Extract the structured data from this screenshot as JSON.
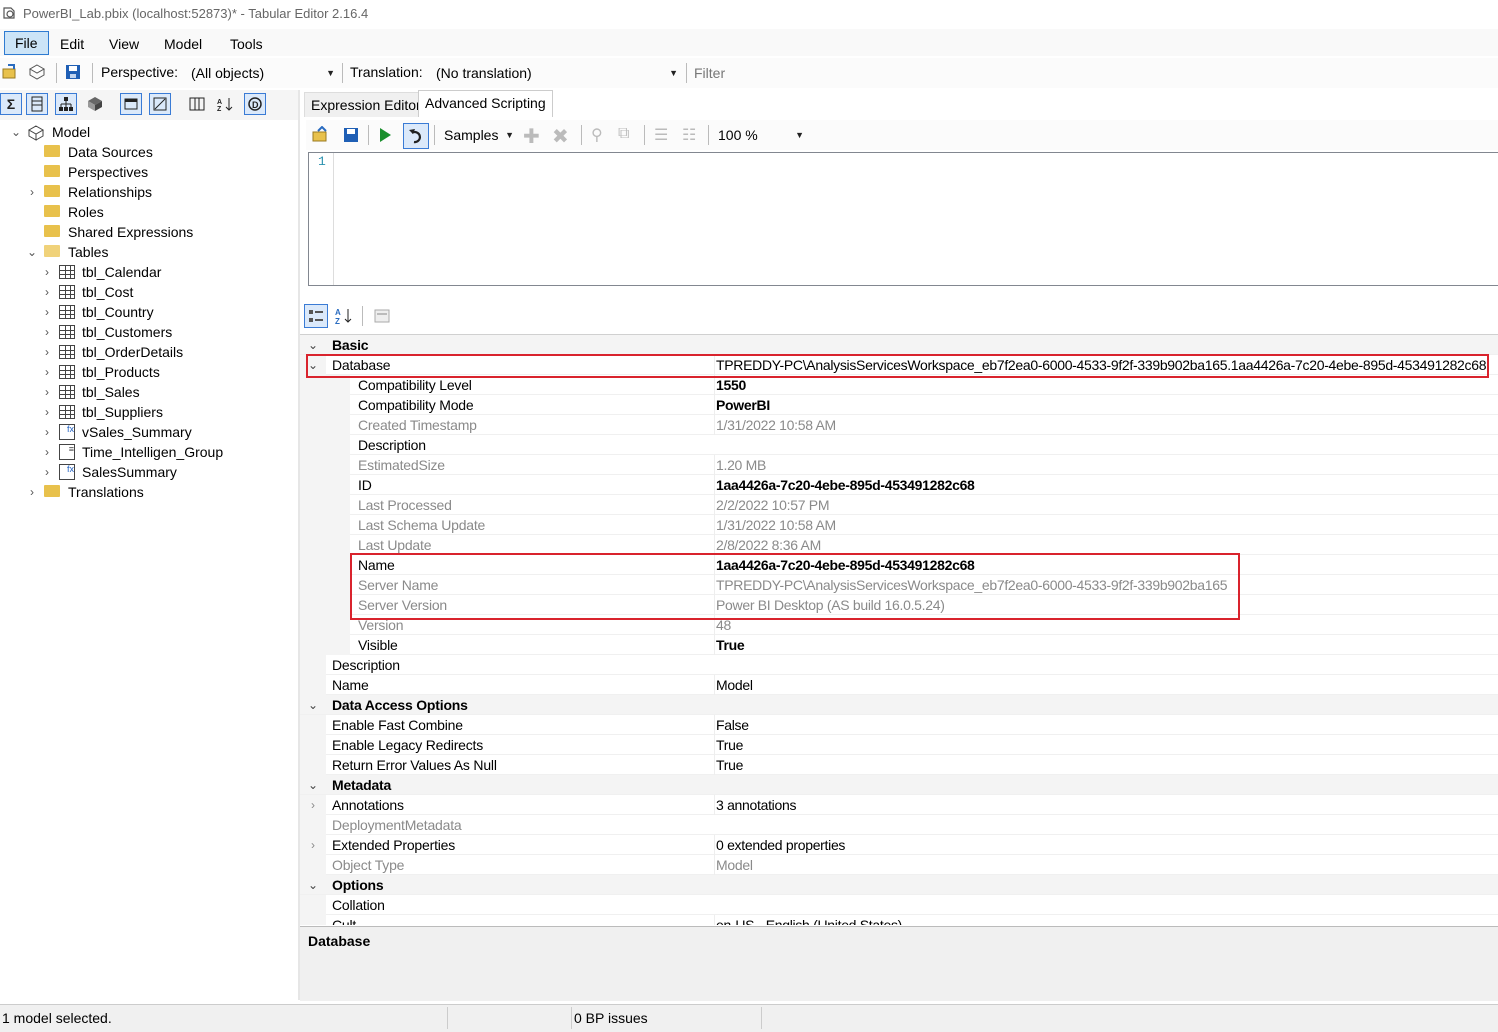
{
  "window": {
    "title": "PowerBI_Lab.pbix (localhost:52873)* - Tabular Editor 2.16.4"
  },
  "menu": {
    "items": [
      "File",
      "Edit",
      "View",
      "Model",
      "Tools"
    ]
  },
  "toolbar": {
    "perspective_label": "Perspective:",
    "perspective_value": "(All objects)",
    "translation_label": "Translation:",
    "translation_value": "(No translation)",
    "filter_placeholder": "Filter"
  },
  "tree": {
    "root": "Model",
    "items": [
      {
        "label": "Data Sources",
        "icon": "folder-icon"
      },
      {
        "label": "Perspectives",
        "icon": "folder-icon"
      },
      {
        "label": "Relationships",
        "icon": "folder-icon"
      },
      {
        "label": "Roles",
        "icon": "folder-icon"
      },
      {
        "label": "Shared Expressions",
        "icon": "folder-icon"
      },
      {
        "label": "Tables",
        "icon": "folder-open-icon"
      },
      {
        "label": "tbl_Calendar",
        "icon": "table-icon"
      },
      {
        "label": "tbl_Cost",
        "icon": "table-icon"
      },
      {
        "label": "tbl_Country",
        "icon": "table-icon"
      },
      {
        "label": "tbl_Customers",
        "icon": "table-icon"
      },
      {
        "label": "tbl_OrderDetails",
        "icon": "table-icon"
      },
      {
        "label": "tbl_Products",
        "icon": "table-icon"
      },
      {
        "label": "tbl_Sales",
        "icon": "table-icon"
      },
      {
        "label": "tbl_Suppliers",
        "icon": "table-icon"
      },
      {
        "label": "vSales_Summary",
        "icon": "calculated-table-icon"
      },
      {
        "label": "Time_Intelligen_Group",
        "icon": "calculation-group-icon"
      },
      {
        "label": "SalesSummary",
        "icon": "calculated-table-icon"
      },
      {
        "label": "Translations",
        "icon": "folder-icon"
      }
    ]
  },
  "tabs": [
    "Expression Editor",
    "Advanced Scripting"
  ],
  "script_toolbar": {
    "samples_label": "Samples",
    "zoom": "100 %"
  },
  "editor": {
    "line_number": "1"
  },
  "properties": {
    "cat_basic": "Basic",
    "database": {
      "name": "Database",
      "value": "TPREDDY-PC\\AnalysisServicesWorkspace_eb7f2ea0-6000-4533-9f2f-339b902ba165.1aa4426a-7c20-4ebe-895d-453491282c68"
    },
    "compat_level": {
      "name": "Compatibility Level",
      "value": "1550"
    },
    "compat_mode": {
      "name": "Compatibility Mode",
      "value": "PowerBI"
    },
    "created": {
      "name": "Created Timestamp",
      "value": "1/31/2022 10:58 AM"
    },
    "db_description": {
      "name": "Description",
      "value": ""
    },
    "est_size": {
      "name": "EstimatedSize",
      "value": "1.20 MB"
    },
    "id": {
      "name": "ID",
      "value": "1aa4426a-7c20-4ebe-895d-453491282c68"
    },
    "last_processed": {
      "name": "Last Processed",
      "value": "2/2/2022 10:57 PM"
    },
    "last_schema_update": {
      "name": "Last Schema Update",
      "value": "1/31/2022 10:58 AM"
    },
    "last_update": {
      "name": "Last Update",
      "value": "2/8/2022 8:36 AM"
    },
    "db_name": {
      "name": "Name",
      "value": "1aa4426a-7c20-4ebe-895d-453491282c68"
    },
    "server_name": {
      "name": "Server Name",
      "value": "TPREDDY-PC\\AnalysisServicesWorkspace_eb7f2ea0-6000-4533-9f2f-339b902ba165"
    },
    "server_version": {
      "name": "Server Version",
      "value": "Power BI Desktop (AS build 16.0.5.24)"
    },
    "version": {
      "name": "Version",
      "value": "48"
    },
    "visible": {
      "name": "Visible",
      "value": "True"
    },
    "description": {
      "name": "Description",
      "value": ""
    },
    "name": {
      "name": "Name",
      "value": "Model"
    },
    "cat_data_access": "Data Access Options",
    "fast_combine": {
      "name": "Enable Fast Combine",
      "value": "False"
    },
    "legacy_redirects": {
      "name": "Enable Legacy Redirects",
      "value": "True"
    },
    "return_error_null": {
      "name": "Return Error Values As Null",
      "value": "True"
    },
    "cat_metadata": "Metadata",
    "annotations": {
      "name": "Annotations",
      "value": "3 annotations"
    },
    "deployment_metadata": {
      "name": "DeploymentMetadata",
      "value": ""
    },
    "extended_props": {
      "name": "Extended Properties",
      "value": "0 extended properties"
    },
    "object_type": {
      "name": "Object Type",
      "value": "Model"
    },
    "cat_options": "Options",
    "collation": {
      "name": "Collation",
      "value": ""
    },
    "culture_partial": {
      "name": "Cult",
      "value": "en-US - English (United States)"
    }
  },
  "description_panel": {
    "title": "Database"
  },
  "status": {
    "selection": "1 model selected.",
    "bp_issues": "0 BP issues"
  },
  "colors": {
    "highlight_red": "#d9232d",
    "menu_active": "#cce4f7",
    "accent_blue": "#2f7bd1"
  }
}
